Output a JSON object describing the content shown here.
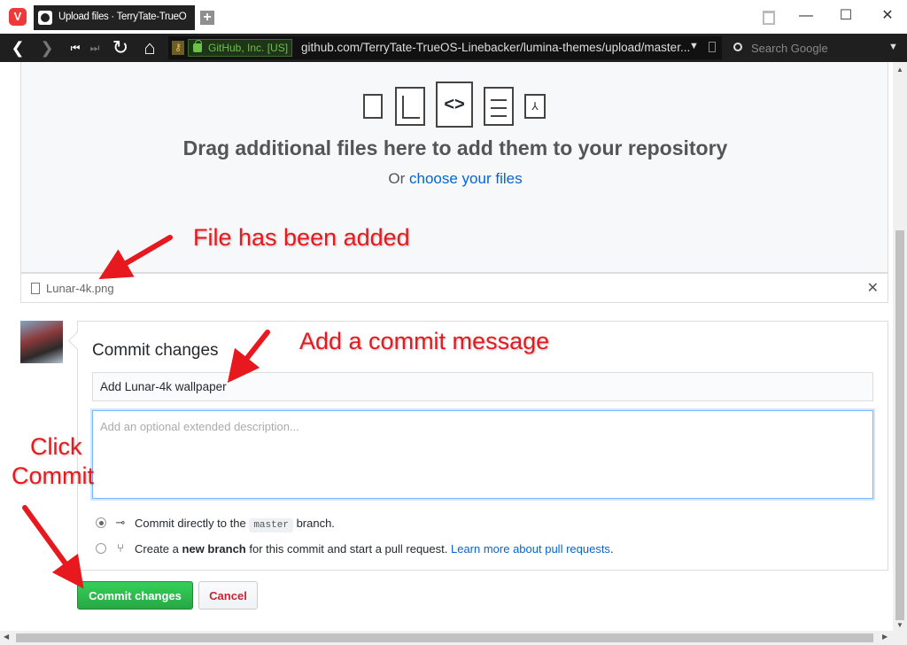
{
  "browser": {
    "logo": "V",
    "tab_title": "Upload files · TerryTate-TrueO",
    "new_tab": "+",
    "window_controls": {
      "minimize": "—",
      "maximize": "☐",
      "close": "✕"
    },
    "nav": {
      "back": "❮",
      "forward": "❯",
      "first": "⏮",
      "last": "⏭",
      "reload": "↻",
      "home": "⌂"
    },
    "site_identity": "GitHub, Inc. [US]",
    "url": "github.com/TerryTate-TrueOS-Linebacker/lumina-themes/upload/master...",
    "url_dropdown": "▼",
    "search_placeholder": "Search Google",
    "search_dropdown": "▼"
  },
  "dropzone": {
    "icons": [
      "zip-file-icon",
      "chart-file-icon",
      "code-file-icon",
      "text-file-icon",
      "pdf-file-icon"
    ],
    "code_glyph": "<>",
    "pdf_glyph": "⅄",
    "title": "Drag additional files here to add them to your repository",
    "sub_prefix": "Or",
    "sub_link": "choose your files"
  },
  "uploaded_file": {
    "name": "Lunar-4k.png",
    "remove": "✕"
  },
  "commit": {
    "title": "Commit changes",
    "message": "Add Lunar-4k wallpaper",
    "description_placeholder": "Add an optional extended description...",
    "option_direct": {
      "checked": true,
      "icon": "⊸",
      "text_before": "Commit directly to the",
      "branch": "master",
      "text_after": "branch."
    },
    "option_new_branch": {
      "checked": false,
      "icon": "⑂",
      "text_before": "Create a",
      "bold": "new branch",
      "text_after": "for this commit and start a pull request.",
      "link": "Learn more about pull requests",
      "period": "."
    },
    "submit_label": "Commit changes",
    "cancel_label": "Cancel"
  },
  "annotations": {
    "file_added": "File has been added",
    "commit_message": "Add a commit message",
    "click": "Click",
    "commit": "Commit",
    "color": "#e8191e"
  },
  "scrollbars": {
    "up": "▲",
    "down": "▼",
    "left": "◀",
    "right": "▶"
  }
}
